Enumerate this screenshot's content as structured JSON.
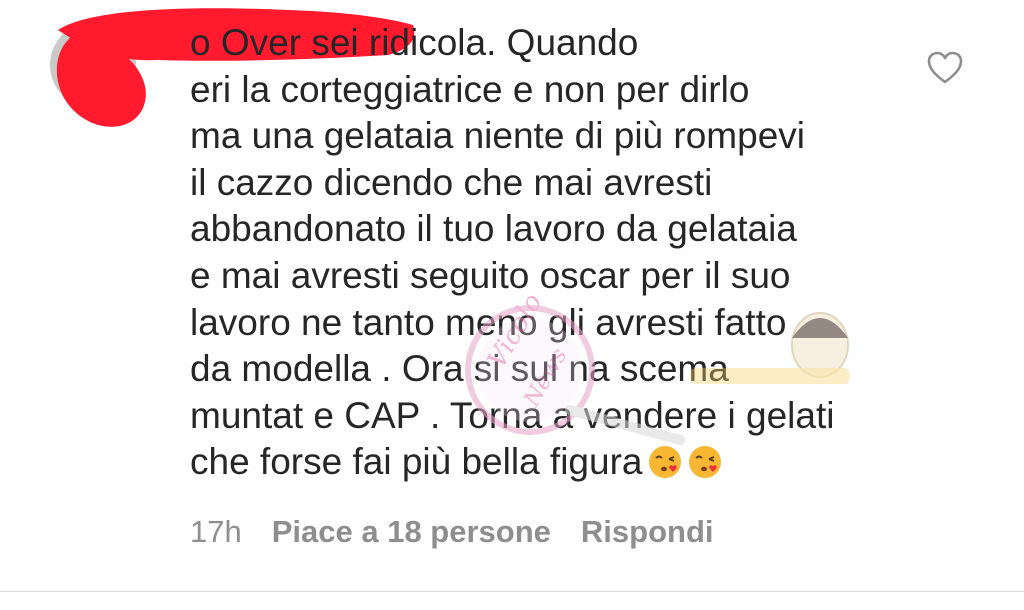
{
  "comment": {
    "text": "o Over sei ridicola. Quando\neri la corteggiatrice e non per dirlo\nma una gelataia niente di più rompevi\nil cazzo dicendo che mai avresti\nabbandonato il tuo lavoro da gelataia\ne mai avresti seguito oscar per il suo\nlavoro ne tanto meno gli avresti fatto\nda modella . Ora si sul na scema\nmuntat e CAP . Torna a vendere i gelati\nche forse fai più bella figura",
    "emojis": [
      "kissing-face-emoji",
      "kissing-face-emoji"
    ]
  },
  "meta": {
    "time": "17h",
    "likes": "Piace a 18 persone",
    "reply": "Rispondi"
  },
  "icons": {
    "like": "heart-outline-icon"
  },
  "colors": {
    "text": "#262626",
    "secondary": "#8e8e8e",
    "redaction": "#ff1a2e"
  },
  "watermark": {
    "text": "Vicolo delle News"
  }
}
